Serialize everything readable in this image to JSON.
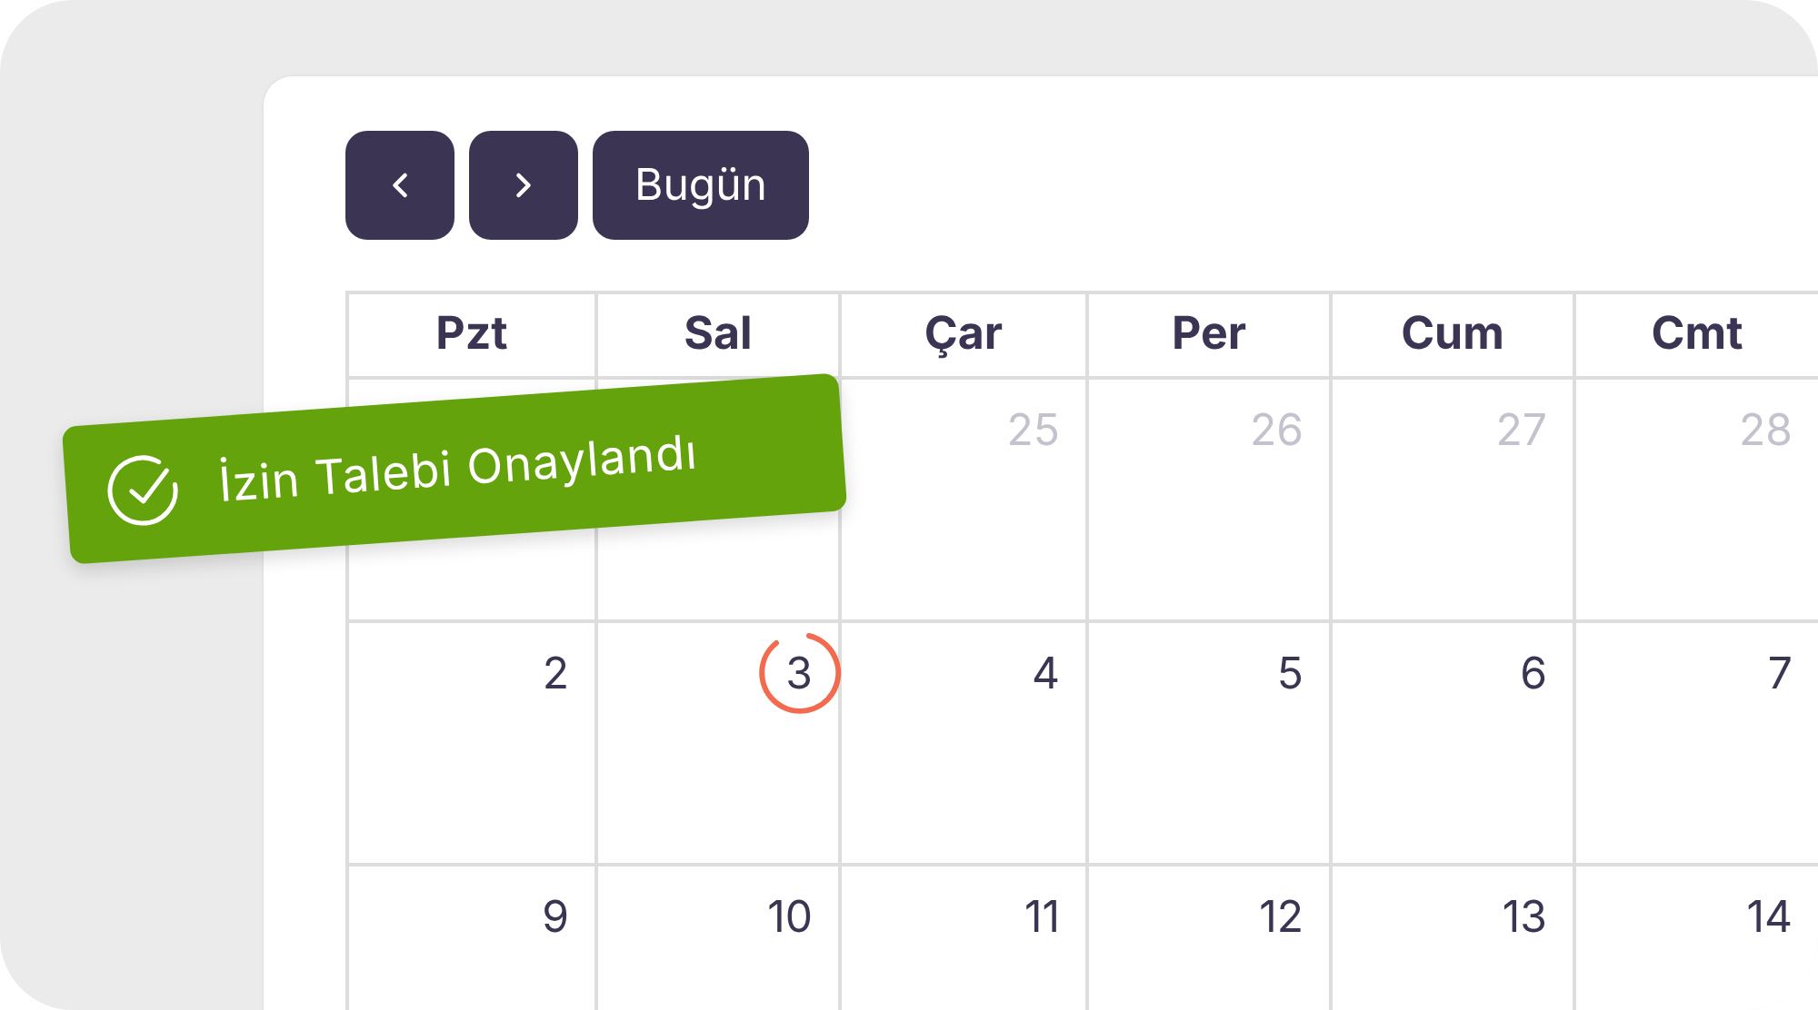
{
  "toolbar": {
    "today_button": "Bugün"
  },
  "weekdays": [
    "Pzt",
    "Sal",
    "Çar",
    "Per",
    "Cum",
    "Cmt"
  ],
  "weeks": [
    [
      {
        "day": "25",
        "other_month": true,
        "today": false
      },
      {
        "day": "26",
        "other_month": true,
        "today": false
      },
      {
        "day": "27",
        "other_month": true,
        "today": false
      },
      {
        "day": "28",
        "other_month": true,
        "today": false
      }
    ],
    [
      {
        "day": "2",
        "other_month": false,
        "today": false
      },
      {
        "day": "3",
        "other_month": false,
        "today": true
      },
      {
        "day": "4",
        "other_month": false,
        "today": false
      },
      {
        "day": "5",
        "other_month": false,
        "today": false
      },
      {
        "day": "6",
        "other_month": false,
        "today": false
      },
      {
        "day": "7",
        "other_month": false,
        "today": false
      }
    ],
    [
      {
        "day": "9",
        "other_month": false,
        "today": false
      },
      {
        "day": "10",
        "other_month": false,
        "today": false
      },
      {
        "day": "11",
        "other_month": false,
        "today": false
      },
      {
        "day": "12",
        "other_month": false,
        "today": false
      },
      {
        "day": "13",
        "other_month": false,
        "today": false
      },
      {
        "day": "14",
        "other_month": false,
        "today": false
      }
    ]
  ],
  "toast": {
    "message": "İzin Talebi Onaylandı"
  }
}
